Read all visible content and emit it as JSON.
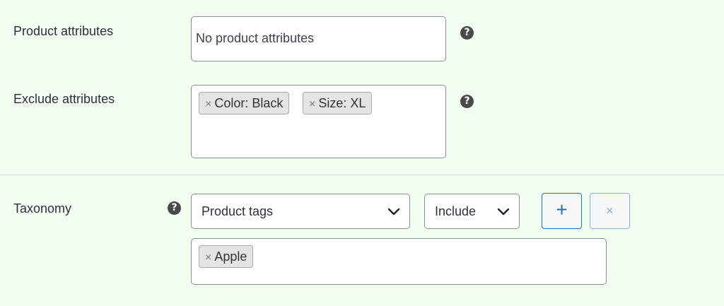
{
  "product_attributes": {
    "label": "Product attributes",
    "value": "No product attributes",
    "help_icon": "question-circle-icon"
  },
  "exclude_attributes": {
    "label": "Exclude attributes",
    "chips": [
      {
        "remove": "×",
        "text": "Color: Black"
      },
      {
        "remove": "×",
        "text": "Size: XL"
      }
    ],
    "help_icon": "question-circle-icon"
  },
  "taxonomy": {
    "label": "Taxonomy",
    "help_icon": "question-circle-icon",
    "taxonomy_select": "Product tags",
    "mode_select": "Include",
    "add_button": "+",
    "remove_button": "×",
    "chips": [
      {
        "remove": "×",
        "text": "Apple"
      }
    ]
  },
  "colors": {
    "background": "#f0fdf0",
    "accent": "#2271b1"
  }
}
